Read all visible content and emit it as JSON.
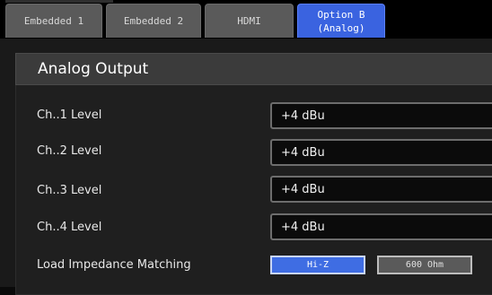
{
  "tabs": [
    {
      "label": "Embedded 1",
      "active": false
    },
    {
      "label": "Embedded 2",
      "active": false
    },
    {
      "label": "HDMI",
      "active": false
    },
    {
      "label_line1": "Option B",
      "label_line2": "(Analog)",
      "active": true
    }
  ],
  "panel": {
    "title": "Analog Output",
    "rows": [
      {
        "label": "Ch..1 Level",
        "value": "+4 dBu"
      },
      {
        "label": "Ch..2 Level",
        "value": "+4 dBu"
      },
      {
        "label": "Ch..3 Level",
        "value": "+4 dBu"
      },
      {
        "label": "Ch..4 Level",
        "value": "+4 dBu"
      }
    ],
    "impedance": {
      "label": "Load Impedance Matching",
      "options": [
        {
          "label": "Hi-Z",
          "selected": true
        },
        {
          "label": "600 Ohm",
          "selected": false
        }
      ]
    }
  },
  "colors": {
    "accent": "#3a63e0",
    "tab_inactive": "#5a5a5a",
    "panel_header": "#3b3b3b",
    "background": "#1a1a1a"
  }
}
